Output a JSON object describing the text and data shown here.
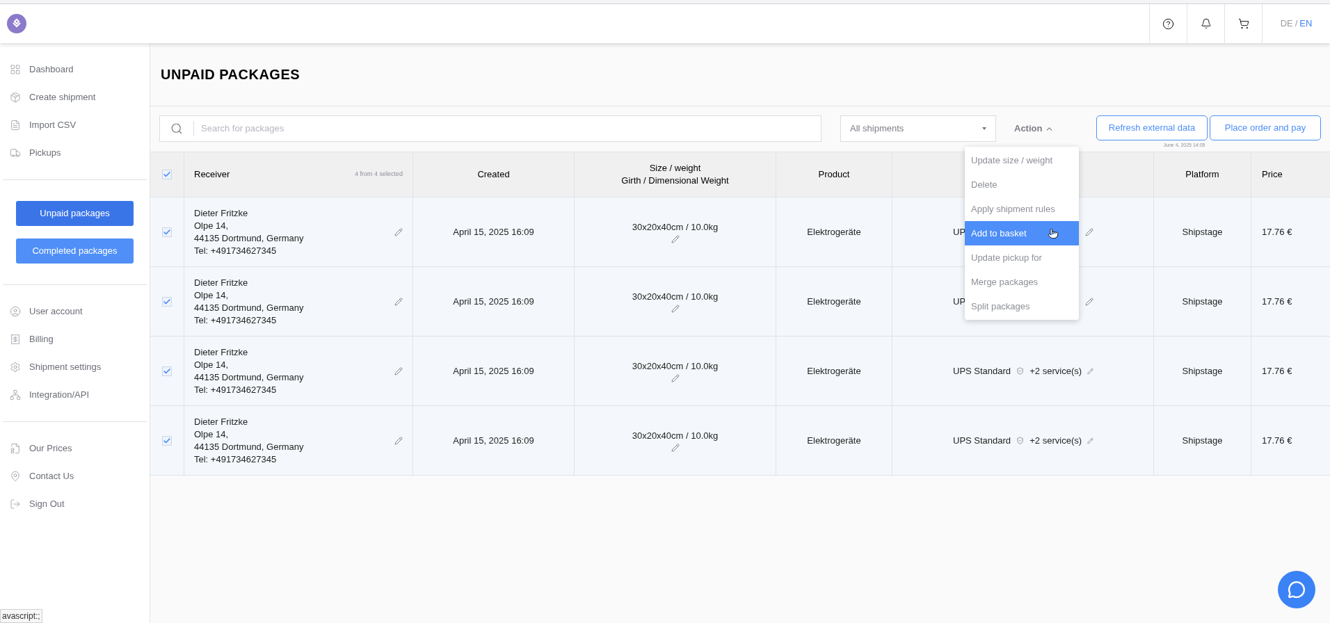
{
  "header": {
    "languages": [
      {
        "label": "DE",
        "selected": false
      },
      {
        "label": "EN",
        "selected": true
      }
    ],
    "language_separator": "/"
  },
  "sidebar": {
    "main_items": [
      {
        "label": "Dashboard"
      },
      {
        "label": "Create shipment"
      },
      {
        "label": "Import CSV"
      },
      {
        "label": "Pickups"
      }
    ],
    "package_buttons": [
      {
        "label": "Unpaid packages",
        "selected": true
      },
      {
        "label": "Completed packages",
        "selected": false
      }
    ],
    "account_items": [
      {
        "label": "User account"
      },
      {
        "label": "Billing"
      },
      {
        "label": "Shipment settings"
      },
      {
        "label": "Integration/API"
      }
    ],
    "footer_items": [
      {
        "label": "Our Prices"
      },
      {
        "label": "Contact Us"
      },
      {
        "label": "Sign Out"
      }
    ]
  },
  "page_title": "UNPAID PACKAGES",
  "toolbar": {
    "search_placeholder": "Search for packages",
    "filter_value": "All shipments",
    "action": {
      "label": "Action",
      "expanded": true
    },
    "buttons": [
      {
        "label": "Refresh external data"
      },
      {
        "label": "Place order and pay"
      }
    ],
    "timestamp": "June 4, 2025 14:05"
  },
  "action_menu": [
    {
      "label": "Update size / weight",
      "selected": false
    },
    {
      "label": "Delete",
      "selected": false
    },
    {
      "label": "Apply shipment rules",
      "selected": false
    },
    {
      "label": "Add to basket",
      "selected": true
    },
    {
      "label": "Update pickup for",
      "selected": false
    },
    {
      "label": "Merge packages",
      "selected": false
    },
    {
      "label": "Split packages",
      "selected": false
    }
  ],
  "table": {
    "all_checked": true,
    "selection_count": "4 from 4 selected",
    "columns": {
      "receiver": "Receiver",
      "created": "Created",
      "size_line_1": "Size / weight",
      "size_line_2": "Girth / Dimensional Weight",
      "product": "Product",
      "platform": "Platform",
      "price": "Price"
    },
    "rows": [
      {
        "checked": true,
        "receiver": [
          "Dieter Fritzke",
          "Olpe 14,",
          "44135 Dortmund, Germany",
          "Tel: +491734627345"
        ],
        "created": "April 15, 2025 16:09",
        "size": "30x20x40cm / 10.0kg",
        "product": "Elektrogeräte",
        "service": "UP",
        "platform": "Shipstage",
        "price": "17.76 €"
      },
      {
        "checked": true,
        "receiver": [
          "Dieter Fritzke",
          "Olpe 14,",
          "44135 Dortmund, Germany",
          "Tel: +491734627345"
        ],
        "created": "April 15, 2025 16:09",
        "size": "30x20x40cm / 10.0kg",
        "product": "Elektrogeräte",
        "service": "UP",
        "platform": "Shipstage",
        "price": "17.76 €"
      },
      {
        "checked": true,
        "receiver": [
          "Dieter Fritzke",
          "Olpe 14,",
          "44135 Dortmund, Germany",
          "Tel: +491734627345"
        ],
        "created": "April 15, 2025 16:09",
        "size": "30x20x40cm / 10.0kg",
        "product": "Elektrogeräte",
        "service": "UPS Standard",
        "insured": true,
        "extras": "+2 service(s)",
        "platform": "Shipstage",
        "price": "17.76 €"
      },
      {
        "checked": true,
        "receiver": [
          "Dieter Fritzke",
          "Olpe 14,",
          "44135 Dortmund, Germany",
          "Tel: +491734627345"
        ],
        "created": "April 15, 2025 16:09",
        "size": "30x20x40cm / 10.0kg",
        "product": "Elektrogeräte",
        "service": "UPS Standard",
        "insured": true,
        "extras": "+2 service(s)",
        "platform": "Shipstage",
        "price": "17.76 €"
      }
    ]
  },
  "status_link": "avascript:;"
}
